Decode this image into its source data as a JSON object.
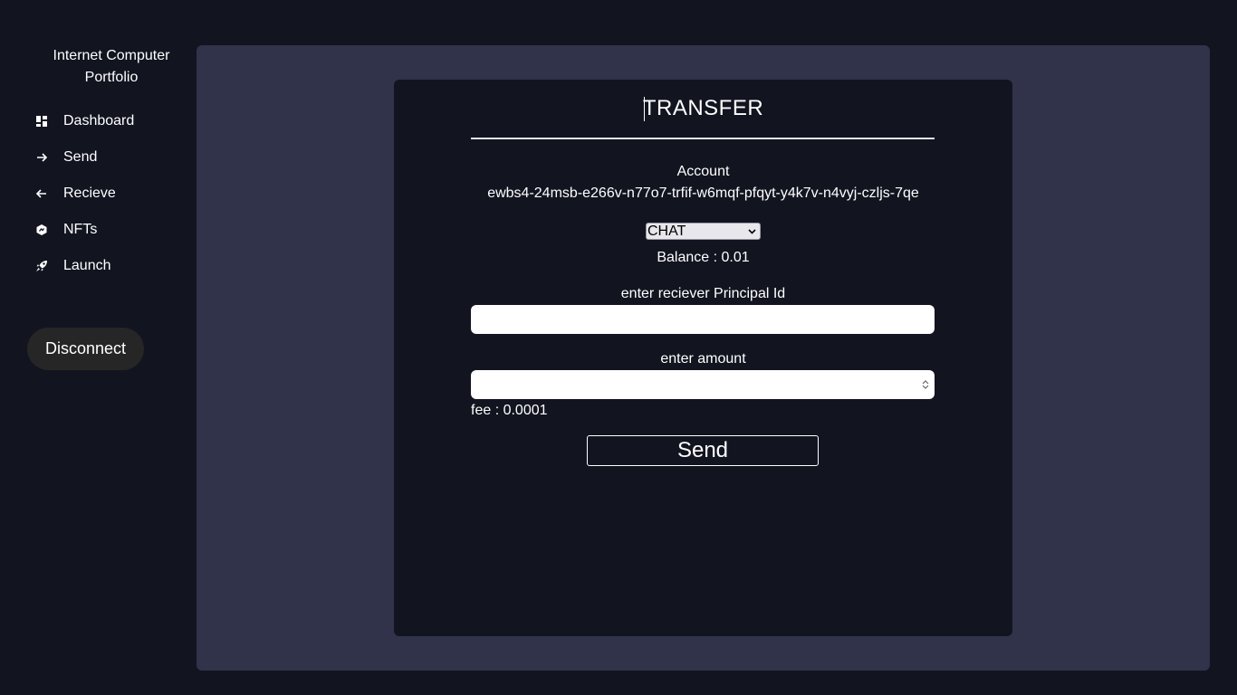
{
  "sidebar": {
    "brand": "Internet Computer Portfolio",
    "items": [
      {
        "label": "Dashboard",
        "icon": "dashboard-icon"
      },
      {
        "label": "Send",
        "icon": "arrow-right-icon"
      },
      {
        "label": "Recieve",
        "icon": "arrow-left-icon"
      },
      {
        "label": "NFTs",
        "icon": "nft-icon"
      },
      {
        "label": "Launch",
        "icon": "rocket-icon"
      }
    ],
    "disconnect_label": "Disconnect"
  },
  "transfer": {
    "title": "TRANSFER",
    "account_label": "Account",
    "account_id": "ewbs4-24msb-e266v-n77o7-trfif-w6mqf-pfqyt-y4k7v-n4vyj-czljs-7qe",
    "token_selected": "CHAT",
    "balance_text": "Balance : 0.01",
    "principal_label": "enter reciever Principal Id",
    "principal_value": "",
    "amount_label": "enter amount",
    "amount_value": "",
    "fee_text": "fee : 0.0001",
    "send_label": "Send"
  },
  "colors": {
    "background": "#121420",
    "panel": "#30334a",
    "card": "#121420",
    "disconnect_bg": "#262626"
  }
}
